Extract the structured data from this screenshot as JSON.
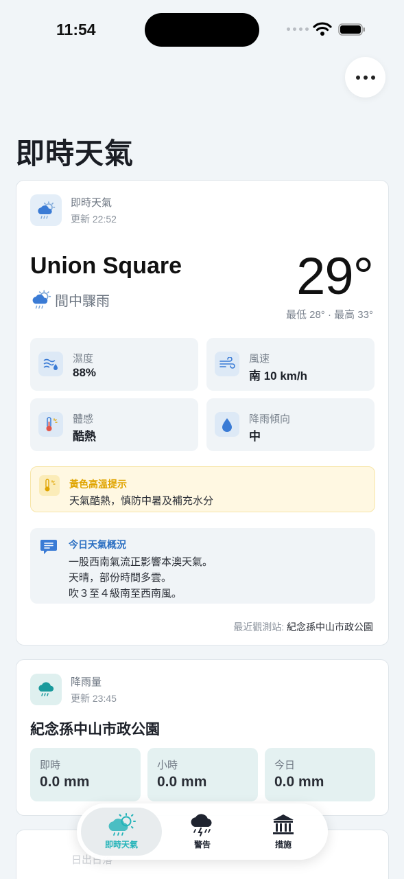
{
  "status_bar": {
    "time": "11:54"
  },
  "page": {
    "title": "即時天氣"
  },
  "weather_card": {
    "header_title": "即時天氣",
    "header_updated": "更新 22:52",
    "location": "Union Square",
    "condition": "間中驟雨",
    "temperature": "29°",
    "min_max": "最低 28° · 最高 33°",
    "tiles": [
      {
        "label": "濕度",
        "value": "88%",
        "icon": "humidity-icon"
      },
      {
        "label": "風速",
        "value": "南 10 km/h",
        "icon": "wind-icon"
      },
      {
        "label": "體感",
        "value": "酷熱",
        "icon": "thermometer-icon"
      },
      {
        "label": "降雨傾向",
        "value": "中",
        "icon": "raindrop-icon"
      }
    ],
    "alert": {
      "title": "黃色高溫提示",
      "text": "天氣酷熱，慎防中暑及補充水分",
      "color": "#e0a400"
    },
    "summary": {
      "title": "今日天氣概況",
      "lines": [
        "一股西南氣流正影響本澳天氣。",
        "天晴，部份時間多雲。",
        "吹３至４級南至西南風。"
      ]
    },
    "station_label": "最近觀測站:",
    "station_name": "紀念孫中山市政公園"
  },
  "rain_card": {
    "header_title": "降雨量",
    "header_updated": "更新 23:45",
    "location": "紀念孫中山市政公園",
    "tiles": [
      {
        "label": "即時",
        "value": "0.0 mm"
      },
      {
        "label": "小時",
        "value": "0.0 mm"
      },
      {
        "label": "今日",
        "value": "0.0 mm"
      }
    ]
  },
  "sun_card": {
    "header_title": "日出日落"
  },
  "tab_bar": {
    "tabs": [
      {
        "label": "即時天氣",
        "active": true,
        "icon": "partly-cloudy-rain-icon"
      },
      {
        "label": "警告",
        "active": false,
        "icon": "storm-cloud-icon"
      },
      {
        "label": "措施",
        "active": false,
        "icon": "government-building-icon"
      }
    ],
    "accent": "#22b3b8"
  }
}
